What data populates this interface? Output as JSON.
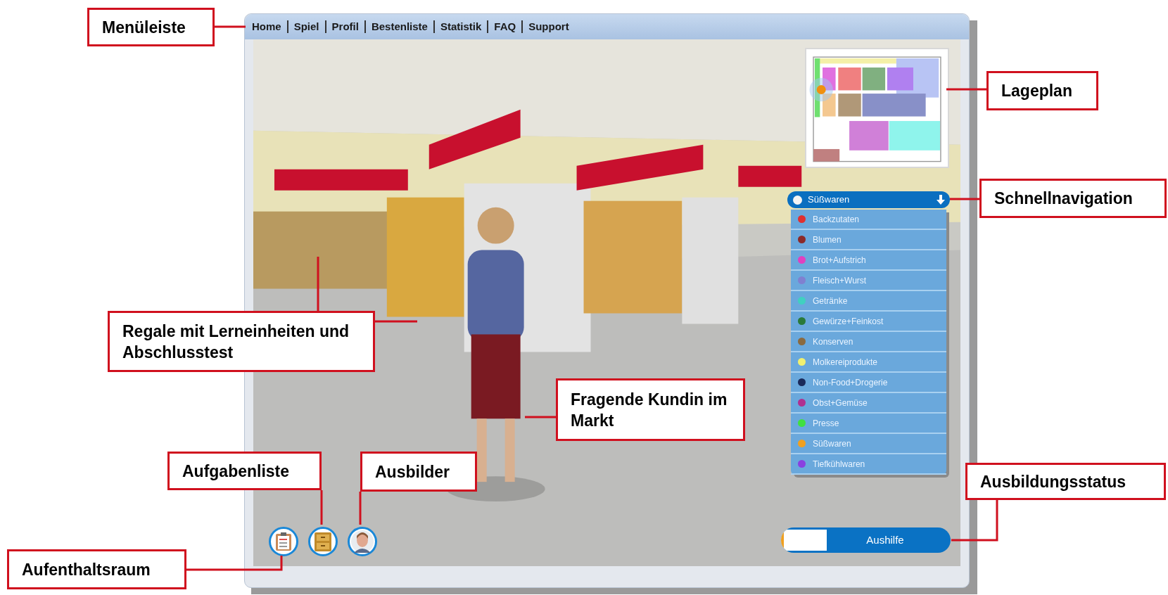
{
  "menu_bar": {
    "items": [
      "Home",
      "Spiel",
      "Profil",
      "Bestenliste",
      "Statistik",
      "FAQ",
      "Support"
    ]
  },
  "quick_navigation": {
    "current": "Süßwaren",
    "items": [
      {
        "label": "Backzutaten",
        "color": "#e03030"
      },
      {
        "label": "Blumen",
        "color": "#8b2a2a"
      },
      {
        "label": "Brot+Aufstrich",
        "color": "#e040c0"
      },
      {
        "label": "Fleisch+Wurst",
        "color": "#8080d0"
      },
      {
        "label": "Getränke",
        "color": "#40d0c0"
      },
      {
        "label": "Gewürze+Feinkost",
        "color": "#2a7a3a"
      },
      {
        "label": "Konserven",
        "color": "#8a6a40"
      },
      {
        "label": "Molkereiprodukte",
        "color": "#f0f070"
      },
      {
        "label": "Non-Food+Drogerie",
        "color": "#1a2a5a"
      },
      {
        "label": "Obst+Gemüse",
        "color": "#b03090"
      },
      {
        "label": "Presse",
        "color": "#40e040"
      },
      {
        "label": "Süßwaren",
        "color": "#f0a020"
      },
      {
        "label": "Tiefkühlwaren",
        "color": "#8a40e0"
      }
    ]
  },
  "toolbar": [
    {
      "kind": "clipboard"
    },
    {
      "kind": "cabinet"
    },
    {
      "kind": "trainer"
    }
  ],
  "training_status": {
    "label": "Aushilfe",
    "level": 0.27
  },
  "annotations": [
    {
      "text": "Menüleiste"
    },
    {
      "text": "Lageplan"
    },
    {
      "text": "Schnellnavigation"
    },
    {
      "text": "Regale mit Lerneinheiten und Abschlusstest"
    },
    {
      "text": "Fragende Kundin im Markt"
    },
    {
      "text": "Ausbildungsstatus"
    },
    {
      "text": "Aufgabenliste"
    },
    {
      "text": "Ausbilder"
    },
    {
      "text": "Aufenthaltsraum"
    }
  ]
}
